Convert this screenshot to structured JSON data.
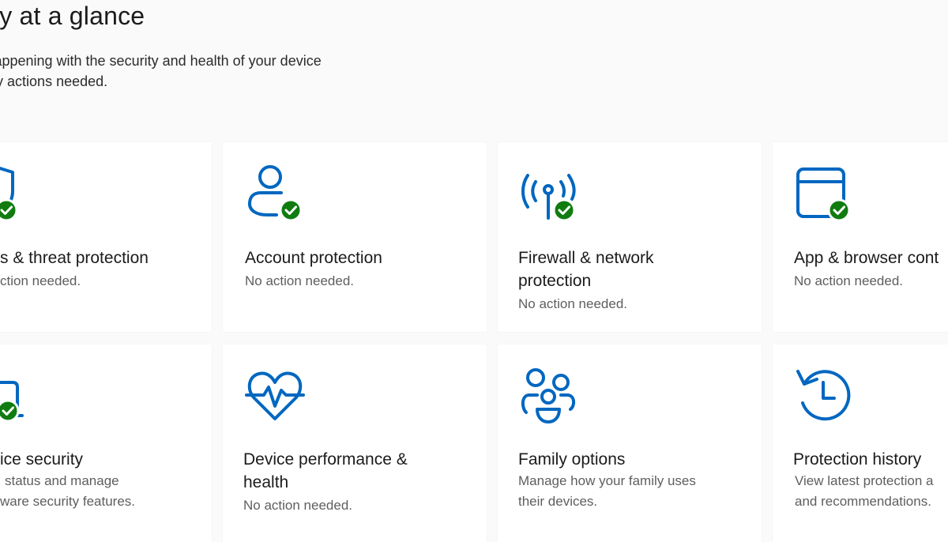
{
  "page": {
    "title": "rity at a glance",
    "subtitle_line1": "t's happening with the security and health of your device",
    "subtitle_line2": "e any actions needed."
  },
  "colors": {
    "accent": "#0067c0",
    "ok_badge": "#107c10",
    "card_bg": "#ffffff",
    "page_bg": "#fafafa"
  },
  "tiles": [
    {
      "icon": "shield-icon",
      "status_icon": "check-badge-icon",
      "name_line1": "s & threat protection",
      "name_line2": "",
      "desc_line1": "ction needed.",
      "desc_line2": ""
    },
    {
      "icon": "person-icon",
      "status_icon": "check-badge-icon",
      "name_line1": "Account protection",
      "name_line2": "",
      "desc_line1": "No action needed.",
      "desc_line2": ""
    },
    {
      "icon": "wifi-antenna-icon",
      "status_icon": "check-badge-icon",
      "name_line1": "Firewall & network",
      "name_line2": "protection",
      "desc_line1": "No action needed.",
      "desc_line2": ""
    },
    {
      "icon": "browser-window-icon",
      "status_icon": "check-badge-icon",
      "name_line1": "App & browser cont",
      "name_line2": "",
      "desc_line1": "No action needed.",
      "desc_line2": ""
    },
    {
      "icon": "laptop-icon",
      "status_icon": "check-badge-icon",
      "name_line1": "ice security",
      "name_line2": "",
      "desc_line1": "status and manage",
      "desc_line2": "ware security features."
    },
    {
      "icon": "heart-pulse-icon",
      "status_icon": "",
      "name_line1": "Device performance &",
      "name_line2": "health",
      "desc_line1": "No action needed.",
      "desc_line2": ""
    },
    {
      "icon": "family-icon",
      "status_icon": "",
      "name_line1": "Family options",
      "name_line2": "",
      "desc_line1": "Manage how your family uses",
      "desc_line2": "their devices."
    },
    {
      "icon": "history-clock-icon",
      "status_icon": "",
      "name_line1": "Protection history",
      "name_line2": "",
      "desc_line1": "View latest protection a",
      "desc_line2": "and recommendations."
    }
  ]
}
